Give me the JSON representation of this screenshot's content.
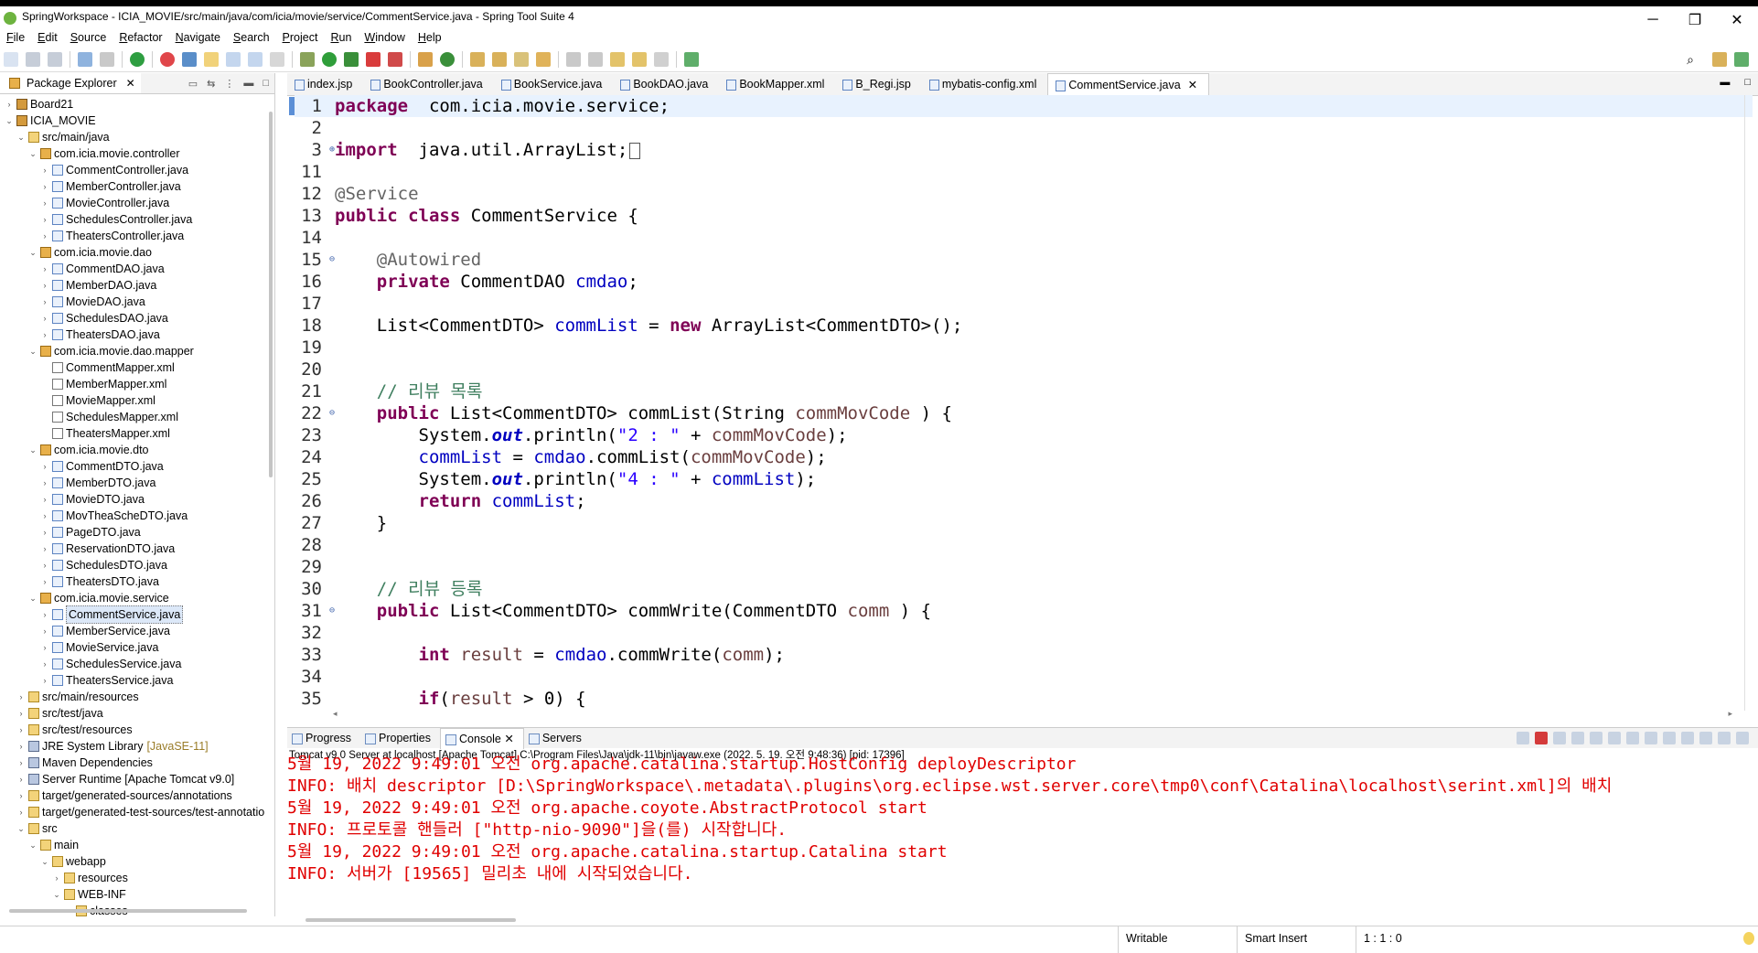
{
  "window": {
    "title": "SpringWorkspace - ICIA_MOVIE/src/main/java/com/icia/movie/service/CommentService.java - Spring Tool Suite 4",
    "minimize": "─",
    "maximize": "❐",
    "close": "✕"
  },
  "menu": [
    "File",
    "Edit",
    "Source",
    "Refactor",
    "Navigate",
    "Search",
    "Project",
    "Run",
    "Window",
    "Help"
  ],
  "package_explorer": {
    "title": "Package Explorer",
    "tree": [
      {
        "indent": 0,
        "twisty": "›",
        "icon": "pr",
        "label": "Board21"
      },
      {
        "indent": 0,
        "twisty": "⌄",
        "icon": "pr",
        "label": "ICIA_MOVIE"
      },
      {
        "indent": 1,
        "twisty": "⌄",
        "icon": "f",
        "label": "src/main/java"
      },
      {
        "indent": 2,
        "twisty": "⌄",
        "icon": "p",
        "label": "com.icia.movie.controller"
      },
      {
        "indent": 3,
        "twisty": "›",
        "icon": "j",
        "label": "CommentController.java"
      },
      {
        "indent": 3,
        "twisty": "›",
        "icon": "j",
        "label": "MemberController.java"
      },
      {
        "indent": 3,
        "twisty": "›",
        "icon": "j",
        "label": "MovieController.java"
      },
      {
        "indent": 3,
        "twisty": "›",
        "icon": "j",
        "label": "SchedulesController.java"
      },
      {
        "indent": 3,
        "twisty": "›",
        "icon": "j",
        "label": "TheatersController.java"
      },
      {
        "indent": 2,
        "twisty": "⌄",
        "icon": "p",
        "label": "com.icia.movie.dao"
      },
      {
        "indent": 3,
        "twisty": "›",
        "icon": "j",
        "label": "CommentDAO.java"
      },
      {
        "indent": 3,
        "twisty": "›",
        "icon": "j",
        "label": "MemberDAO.java"
      },
      {
        "indent": 3,
        "twisty": "›",
        "icon": "j",
        "label": "MovieDAO.java"
      },
      {
        "indent": 3,
        "twisty": "›",
        "icon": "j",
        "label": "SchedulesDAO.java"
      },
      {
        "indent": 3,
        "twisty": "›",
        "icon": "j",
        "label": "TheatersDAO.java"
      },
      {
        "indent": 2,
        "twisty": "⌄",
        "icon": "p",
        "label": "com.icia.movie.dao.mapper"
      },
      {
        "indent": 3,
        "twisty": "",
        "icon": "x",
        "label": "CommentMapper.xml"
      },
      {
        "indent": 3,
        "twisty": "",
        "icon": "x",
        "label": "MemberMapper.xml"
      },
      {
        "indent": 3,
        "twisty": "",
        "icon": "x",
        "label": "MovieMapper.xml"
      },
      {
        "indent": 3,
        "twisty": "",
        "icon": "x",
        "label": "SchedulesMapper.xml"
      },
      {
        "indent": 3,
        "twisty": "",
        "icon": "x",
        "label": "TheatersMapper.xml"
      },
      {
        "indent": 2,
        "twisty": "⌄",
        "icon": "p",
        "label": "com.icia.movie.dto"
      },
      {
        "indent": 3,
        "twisty": "›",
        "icon": "j",
        "label": "CommentDTO.java"
      },
      {
        "indent": 3,
        "twisty": "›",
        "icon": "j",
        "label": "MemberDTO.java"
      },
      {
        "indent": 3,
        "twisty": "›",
        "icon": "j",
        "label": "MovieDTO.java"
      },
      {
        "indent": 3,
        "twisty": "›",
        "icon": "j",
        "label": "MovTheaScheDTO.java"
      },
      {
        "indent": 3,
        "twisty": "›",
        "icon": "j",
        "label": "PageDTO.java"
      },
      {
        "indent": 3,
        "twisty": "›",
        "icon": "j",
        "label": "ReservationDTO.java"
      },
      {
        "indent": 3,
        "twisty": "›",
        "icon": "j",
        "label": "SchedulesDTO.java"
      },
      {
        "indent": 3,
        "twisty": "›",
        "icon": "j",
        "label": "TheatersDTO.java"
      },
      {
        "indent": 2,
        "twisty": "⌄",
        "icon": "p",
        "label": "com.icia.movie.service"
      },
      {
        "indent": 3,
        "twisty": "›",
        "icon": "j",
        "label": "CommentService.java",
        "selected": true
      },
      {
        "indent": 3,
        "twisty": "›",
        "icon": "j",
        "label": "MemberService.java"
      },
      {
        "indent": 3,
        "twisty": "›",
        "icon": "j",
        "label": "MovieService.java"
      },
      {
        "indent": 3,
        "twisty": "›",
        "icon": "j",
        "label": "SchedulesService.java"
      },
      {
        "indent": 3,
        "twisty": "›",
        "icon": "j",
        "label": "TheatersService.java"
      },
      {
        "indent": 1,
        "twisty": "›",
        "icon": "f",
        "label": "src/main/resources"
      },
      {
        "indent": 1,
        "twisty": "›",
        "icon": "f",
        "label": "src/test/java"
      },
      {
        "indent": 1,
        "twisty": "›",
        "icon": "f",
        "label": "src/test/resources"
      },
      {
        "indent": 1,
        "twisty": "›",
        "icon": "l",
        "label": "JRE System Library",
        "decoration": "[JavaSE-11]"
      },
      {
        "indent": 1,
        "twisty": "›",
        "icon": "l",
        "label": "Maven Dependencies"
      },
      {
        "indent": 1,
        "twisty": "›",
        "icon": "l",
        "label": "Server Runtime [Apache Tomcat v9.0]"
      },
      {
        "indent": 1,
        "twisty": "›",
        "icon": "f",
        "label": "target/generated-sources/annotations"
      },
      {
        "indent": 1,
        "twisty": "›",
        "icon": "f",
        "label": "target/generated-test-sources/test-annotatio"
      },
      {
        "indent": 1,
        "twisty": "⌄",
        "icon": "f",
        "label": "src"
      },
      {
        "indent": 2,
        "twisty": "⌄",
        "icon": "f",
        "label": "main"
      },
      {
        "indent": 3,
        "twisty": "⌄",
        "icon": "f",
        "label": "webapp"
      },
      {
        "indent": 4,
        "twisty": "›",
        "icon": "f",
        "label": "resources"
      },
      {
        "indent": 4,
        "twisty": "⌄",
        "icon": "f",
        "label": "WEB-INF"
      },
      {
        "indent": 5,
        "twisty": "",
        "icon": "f",
        "label": "classes"
      }
    ]
  },
  "editor": {
    "tabs": [
      {
        "label": "index.jsp"
      },
      {
        "label": "BookController.java"
      },
      {
        "label": "BookService.java"
      },
      {
        "label": "BookDAO.java"
      },
      {
        "label": "BookMapper.xml"
      },
      {
        "label": "B_Regi.jsp"
      },
      {
        "label": "mybatis-config.xml"
      },
      {
        "label": "CommentService.java",
        "active": true
      }
    ],
    "lines": [
      {
        "n": "1",
        "cur": true,
        "tokens": [
          [
            "kw",
            "package"
          ],
          [
            "",
            "  com.icia.movie.service;"
          ]
        ]
      },
      {
        "n": "2",
        "tokens": []
      },
      {
        "n": "3",
        "fold": "⊕",
        "tokens": [
          [
            "kw",
            "import"
          ],
          [
            "",
            "  java.util.ArrayList;"
          ],
          [
            "box",
            " "
          ]
        ]
      },
      {
        "n": "11",
        "tokens": []
      },
      {
        "n": "12",
        "tokens": [
          [
            "an",
            "@Service"
          ]
        ]
      },
      {
        "n": "13",
        "tokens": [
          [
            "kw",
            "public"
          ],
          [
            "",
            " "
          ],
          [
            "kw",
            "class"
          ],
          [
            "",
            " CommentService {"
          ]
        ]
      },
      {
        "n": "14",
        "tokens": []
      },
      {
        "n": "15",
        "fold": "⊖",
        "tokens": [
          [
            "",
            "    "
          ],
          [
            "an",
            "@Autowired"
          ]
        ]
      },
      {
        "n": "16",
        "tokens": [
          [
            "",
            "    "
          ],
          [
            "kw",
            "private"
          ],
          [
            "",
            " CommentDAO "
          ],
          [
            "fd",
            "cmdao"
          ],
          [
            "",
            ";"
          ]
        ]
      },
      {
        "n": "17",
        "tokens": []
      },
      {
        "n": "18",
        "tokens": [
          [
            "",
            "    List<CommentDTO> "
          ],
          [
            "fd",
            "commList"
          ],
          [
            "",
            " = "
          ],
          [
            "kw",
            "new"
          ],
          [
            "",
            " ArrayList<CommentDTO>();"
          ]
        ]
      },
      {
        "n": "19",
        "tokens": []
      },
      {
        "n": "20",
        "tokens": []
      },
      {
        "n": "21",
        "tokens": [
          [
            "",
            "    "
          ],
          [
            "cm",
            "// 리뷰 목록"
          ]
        ]
      },
      {
        "n": "22",
        "fold": "⊖",
        "tokens": [
          [
            "",
            "    "
          ],
          [
            "kw",
            "public"
          ],
          [
            "",
            " List<CommentDTO> commList(String "
          ],
          [
            "prm",
            "commMovCode"
          ],
          [
            "",
            " ) {"
          ]
        ]
      },
      {
        "n": "23",
        "tokens": [
          [
            "",
            "        System."
          ],
          [
            "sfd",
            "out"
          ],
          [
            "",
            ".println("
          ],
          [
            "st",
            "\"2 : \""
          ],
          [
            "",
            " + "
          ],
          [
            "prm",
            "commMovCode"
          ],
          [
            "",
            ");"
          ]
        ]
      },
      {
        "n": "24",
        "tokens": [
          [
            "",
            "        "
          ],
          [
            "fd",
            "commList"
          ],
          [
            "",
            " = "
          ],
          [
            "fd",
            "cmdao"
          ],
          [
            "",
            ".commList("
          ],
          [
            "prm",
            "commMovCode"
          ],
          [
            "",
            ");"
          ]
        ]
      },
      {
        "n": "25",
        "tokens": [
          [
            "",
            "        System."
          ],
          [
            "sfd",
            "out"
          ],
          [
            "",
            ".println("
          ],
          [
            "st",
            "\"4 : \""
          ],
          [
            "",
            " + "
          ],
          [
            "fd",
            "commList"
          ],
          [
            "",
            ");"
          ]
        ]
      },
      {
        "n": "26",
        "tokens": [
          [
            "",
            "        "
          ],
          [
            "kw",
            "return"
          ],
          [
            "",
            " "
          ],
          [
            "fd",
            "commList"
          ],
          [
            "",
            ";"
          ]
        ]
      },
      {
        "n": "27",
        "tokens": [
          [
            "",
            "    }"
          ]
        ]
      },
      {
        "n": "28",
        "tokens": []
      },
      {
        "n": "29",
        "tokens": []
      },
      {
        "n": "30",
        "tokens": [
          [
            "",
            "    "
          ],
          [
            "cm",
            "// 리뷰 등록"
          ]
        ]
      },
      {
        "n": "31",
        "fold": "⊖",
        "tokens": [
          [
            "",
            "    "
          ],
          [
            "kw",
            "public"
          ],
          [
            "",
            " List<CommentDTO> commWrite(CommentDTO "
          ],
          [
            "prm",
            "comm"
          ],
          [
            "",
            " ) {"
          ]
        ]
      },
      {
        "n": "32",
        "tokens": []
      },
      {
        "n": "33",
        "tokens": [
          [
            "",
            "        "
          ],
          [
            "kw",
            "int"
          ],
          [
            "",
            " "
          ],
          [
            "prm",
            "result"
          ],
          [
            "",
            " = "
          ],
          [
            "fd",
            "cmdao"
          ],
          [
            "",
            ".commWrite("
          ],
          [
            "prm",
            "comm"
          ],
          [
            "",
            ");"
          ]
        ]
      },
      {
        "n": "34",
        "tokens": []
      },
      {
        "n": "35",
        "tokens": [
          [
            "",
            "        "
          ],
          [
            "kw",
            "if"
          ],
          [
            "",
            "("
          ],
          [
            "prm",
            "result"
          ],
          [
            "",
            " > 0) {"
          ]
        ]
      }
    ]
  },
  "console": {
    "tabs": [
      {
        "label": "Progress"
      },
      {
        "label": "Properties"
      },
      {
        "label": "Console",
        "active": true,
        "closable": true
      },
      {
        "label": "Servers"
      }
    ],
    "server_line": "Tomcat v9.0 Server at localhost [Apache Tomcat] C:\\Program Files\\Java\\jdk-11\\bin\\javaw.exe  (2022. 5. 19. 오전 9:48:36) [pid: 17396]",
    "log": [
      "5월 19, 2022 9:49:01 오전 org.apache.catalina.startup.HostConfig deployDescriptor",
      "INFO: 배치 descriptor [D:\\SpringWorkspace\\.metadata\\.plugins\\org.eclipse.wst.server.core\\tmp0\\conf\\Catalina\\localhost\\serint.xml]의 배치",
      "5월 19, 2022 9:49:01 오전 org.apache.coyote.AbstractProtocol start",
      "INFO: 프로토콜 핸들러 [\"http-nio-9090\"]을(를) 시작합니다.",
      "5월 19, 2022 9:49:01 오전 org.apache.catalina.startup.Catalina start",
      "INFO: 서버가 [19565] 밀리초 내에 시작되었습니다."
    ]
  },
  "status": {
    "writable": "Writable",
    "insert_mode": "Smart Insert",
    "position": "1 : 1 : 0"
  }
}
